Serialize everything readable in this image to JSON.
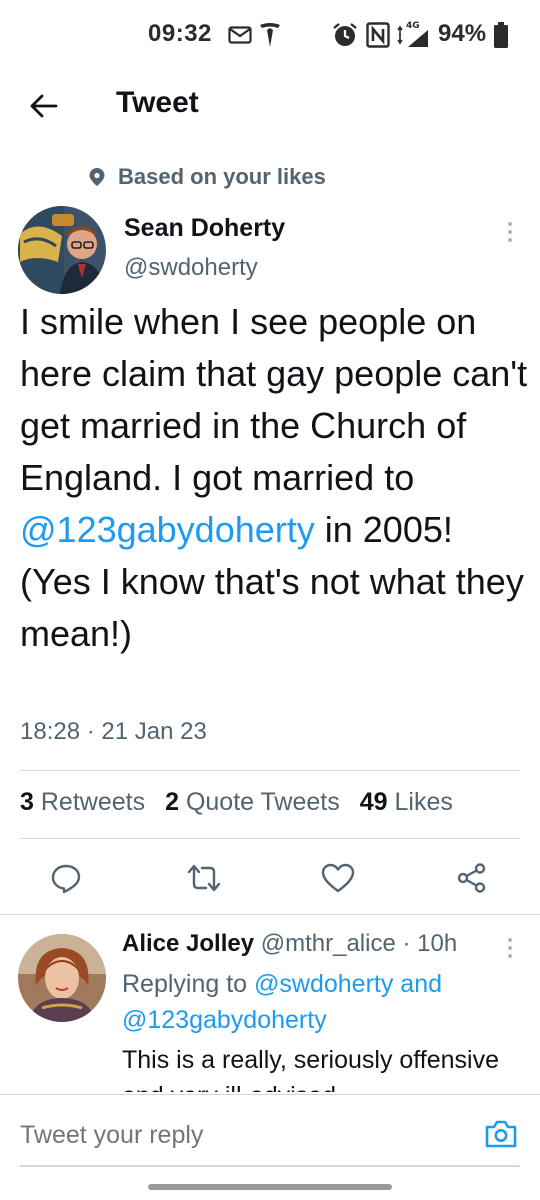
{
  "status_bar": {
    "time": "09:32",
    "network": "4G",
    "battery": "94%"
  },
  "header": {
    "title": "Tweet"
  },
  "tweet": {
    "context": "Based on your likes",
    "author_name": "Sean Doherty",
    "author_handle": "@swdoherty",
    "text_parts": [
      "I smile when I see people on here claim that gay people can't get married in the Church of England. I got married to ",
      "@123gabydoherty",
      " in 2005! (Yes I know that's not what they mean!)"
    ],
    "time": "18:28 · 21 Jan 23",
    "stats": {
      "retweets_count": "3",
      "retweets_label": "Retweets",
      "quotes_count": "2",
      "quotes_label": "Quote Tweets",
      "likes_count": "49",
      "likes_label": "Likes"
    }
  },
  "reply": {
    "name": "Alice Jolley",
    "meta": "@mthr_alice · 10h",
    "replying_prefix": "Replying to ",
    "replying_to_1": "@swdoherty",
    "replying_join": " and",
    "replying_to_2": "@123gabydoherty",
    "text": "This is a really, seriously offensive and very ill-advised"
  },
  "composer": {
    "placeholder": "Tweet your reply"
  },
  "colors": {
    "accent": "#1d9bf0",
    "text": "#0f1419",
    "secondary": "#536471",
    "divider": "#cfd9de"
  },
  "icons": [
    "back-arrow-icon",
    "mail-icon",
    "tesla-icon",
    "alarm-icon",
    "nfc-icon",
    "signal-icon",
    "battery-icon",
    "context-pin-icon",
    "more-icon",
    "reply-icon",
    "retweet-icon",
    "like-icon",
    "share-icon",
    "camera-icon"
  ]
}
